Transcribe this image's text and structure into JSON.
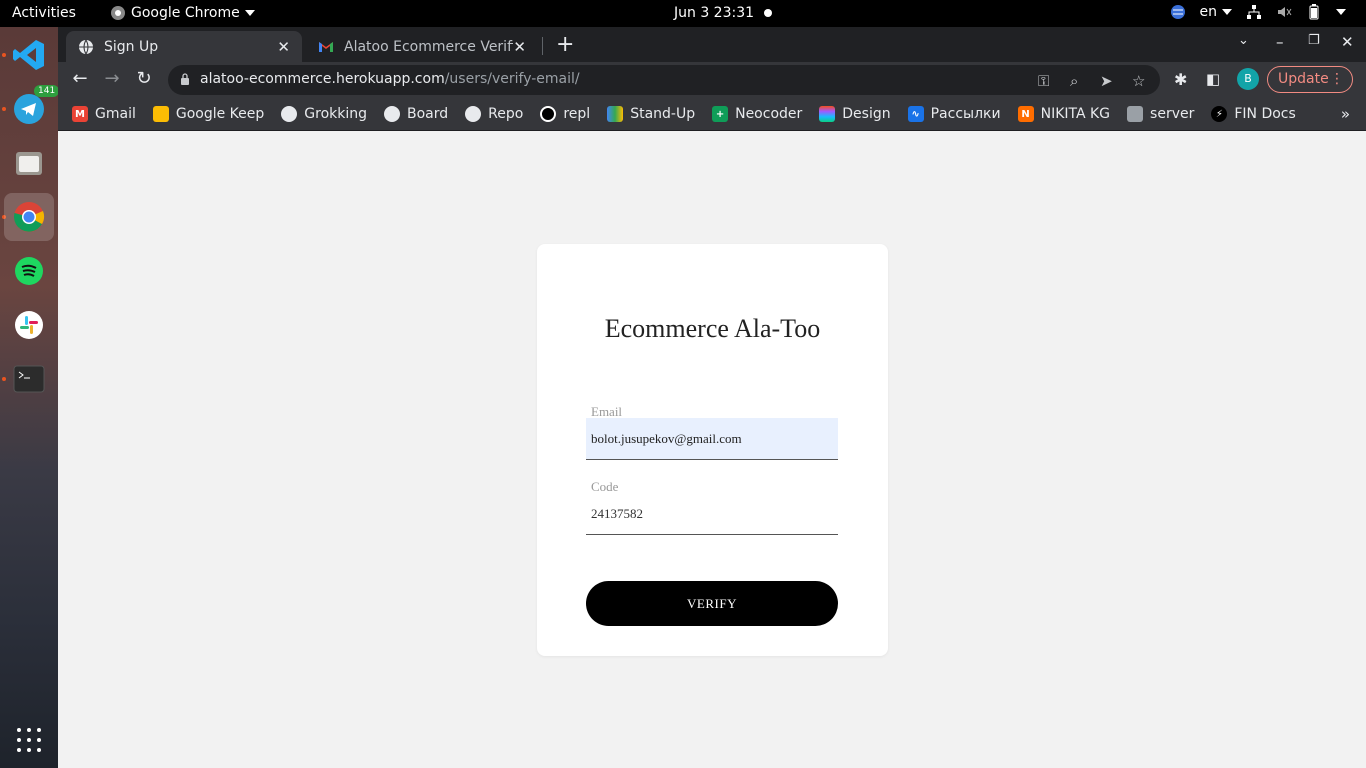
{
  "system": {
    "activities": "Activities",
    "app_name": "Google Chrome",
    "clock": "Jun 3  23:31",
    "lang": "en"
  },
  "dock": {
    "telegram_badge": "141",
    "apps": [
      "vscode-icon",
      "telegram-icon",
      "files-icon",
      "chrome-icon",
      "spotify-icon",
      "slack-icon",
      "terminal-icon"
    ]
  },
  "tabs": [
    {
      "title": "Sign Up",
      "active": true
    },
    {
      "title": "Alatoo Ecommerce Verific",
      "active": false
    }
  ],
  "omnibox": {
    "domain": "alatoo-ecommerce.herokuapp.com",
    "path": "/users/verify-email/"
  },
  "profile_initial": "B",
  "update_label": "Update",
  "bookmarks": [
    {
      "label": "Gmail",
      "color": "#ea4335"
    },
    {
      "label": "Google Keep",
      "color": "#fbbc04"
    },
    {
      "label": "Grokking",
      "color": "#e8eaed"
    },
    {
      "label": "Board",
      "color": "#e8eaed"
    },
    {
      "label": "Repo",
      "color": "#e8eaed"
    },
    {
      "label": "repl",
      "color": "#000000"
    },
    {
      "label": "Stand-Up",
      "color": "#34a853"
    },
    {
      "label": "Neocoder",
      "color": "#0f9d58"
    },
    {
      "label": "Design",
      "color": "#a259ff"
    },
    {
      "label": "Рассылки",
      "color": "#1a73e8"
    },
    {
      "label": "NIKITA KG",
      "color": "#ff6d00"
    },
    {
      "label": "server",
      "color": "#9aa0a6"
    },
    {
      "label": "FIN Docs",
      "color": "#000000"
    }
  ],
  "form": {
    "title": "Ecommerce Ala-Too",
    "email_label": "Email",
    "email_value": "bolot.jusupekov@gmail.com",
    "code_label": "Code",
    "code_value": "24137582",
    "verify_label": "VERIFY"
  }
}
